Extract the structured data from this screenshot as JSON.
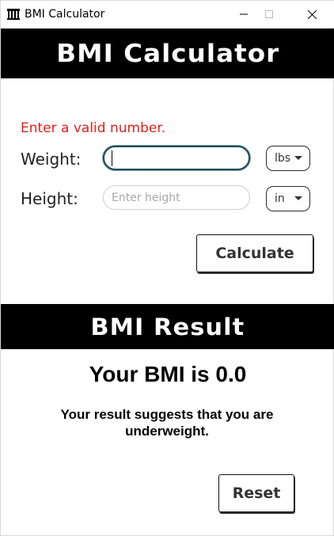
{
  "window": {
    "title": "BMI Calculator",
    "app_icon": "bars-icon",
    "controls": [
      "minimize-icon",
      "maximize-icon",
      "close-icon"
    ]
  },
  "header": {
    "title": "BMI Calculator"
  },
  "form": {
    "error": "Enter a valid number.",
    "weight": {
      "label": "Weight:",
      "value": "",
      "placeholder": "",
      "unit": "lbs"
    },
    "height": {
      "label": "Height:",
      "value": "",
      "placeholder": "Enter height",
      "unit": "in"
    },
    "calculate_label": "Calculate"
  },
  "result": {
    "header": "BMI Result",
    "bmi_text": "Your BMI is 0.0",
    "message": "Your result suggests that you are underweight.",
    "reset_label": "Reset"
  },
  "colors": {
    "banner": "#000000",
    "error": "#e0201a",
    "focus_border": "#1c4a5c"
  }
}
